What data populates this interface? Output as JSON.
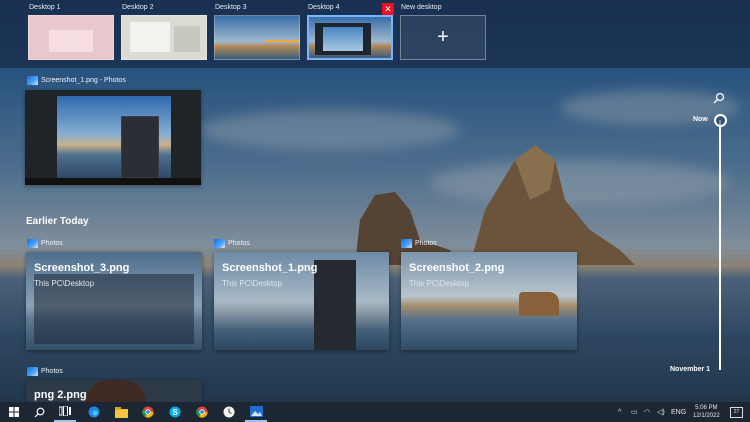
{
  "desktops": [
    {
      "label": "Desktop 1"
    },
    {
      "label": "Desktop 2"
    },
    {
      "label": "Desktop 3"
    },
    {
      "label": "Desktop 4",
      "active": true
    },
    {
      "label": "New desktop"
    }
  ],
  "current_window": {
    "title": "Screenshot_1.png - Photos"
  },
  "earlier": {
    "section_title": "Earlier Today",
    "items": [
      {
        "app": "Photos",
        "title": "Screenshot_3.png",
        "path": "This PC\\Desktop"
      },
      {
        "app": "Photos",
        "title": "Screenshot_1.png",
        "path": "This PC\\Desktop"
      },
      {
        "app": "Photos",
        "title": "Screenshot_2.png",
        "path": "This PC\\Desktop"
      }
    ],
    "next_item": {
      "app": "Photos",
      "title": "png 2.png"
    }
  },
  "timeline": {
    "now_label": "Now",
    "end_label": "November 1"
  },
  "taskbar": {
    "apps": [
      "start-icon",
      "search-icon",
      "task-view-icon",
      "edge-icon",
      "file-explorer-icon",
      "chrome-icon",
      "skype-icon",
      "chrome-icon",
      "clock-app-icon",
      "photos-icon"
    ],
    "language": "ENG",
    "time": "5:06 PM",
    "date": "12/1/2022",
    "notifications": "27"
  },
  "colors": {
    "accent": "#78b5ff",
    "close": "#e81123",
    "taskbar": "#1c2733"
  }
}
